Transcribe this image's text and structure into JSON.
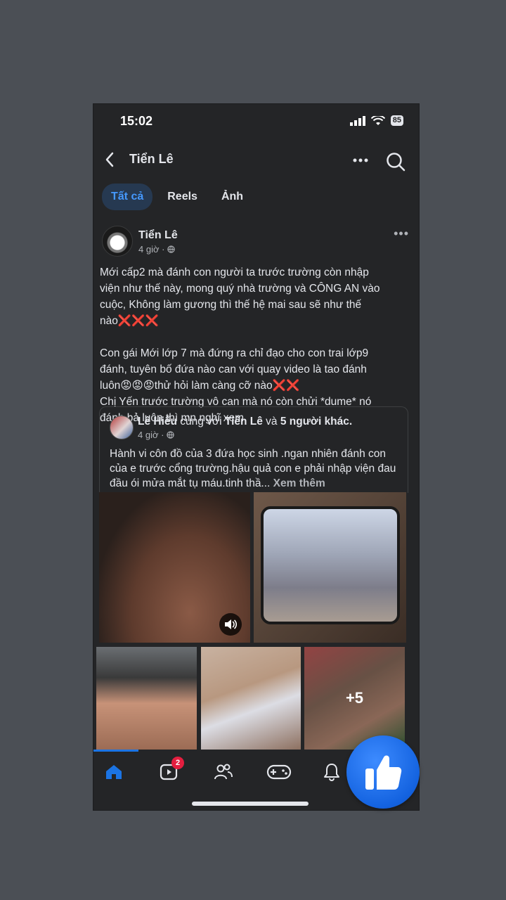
{
  "status": {
    "time": "15:02",
    "battery": "85"
  },
  "header": {
    "title": "Tiển Lê"
  },
  "tabs": [
    {
      "label": "Tất cả"
    },
    {
      "label": "Reels"
    },
    {
      "label": "Ảnh"
    }
  ],
  "post": {
    "author": "Tiển Lê",
    "time": "4 giờ ·",
    "text": "Mới cấp2 mà đánh con người ta trước trường còn nhập\nviện như thế này, mong quý nhà trường và CÔNG AN vào\ncuộc, Không làm gương thì thế hệ mai sau sẽ như thế\nnào❌❌❌\n\nCon gái Mới lớp 7 mà đứng ra chỉ đạo cho con trai lớp9\nđánh, tuyên bố đứa nào can với quay video là tao đánh\nluôn😡😡😡thử hỏi làm càng cỡ nào❌❌\nChị Yến trước trường vô can mà nó còn chửi *dume* nó\nđánh bả luôn thì mn nghĩ xem"
  },
  "shared": {
    "author": "Lê Hiếu",
    "with_text": " cùng với ",
    "tagged": "Tiển Lê",
    "and_text": " và ",
    "others": "5 người khác.",
    "time": "4 giờ ·",
    "text": "Hành vi côn đồ của 3 đứa học sinh .ngan nhiên đánh con của e trước cổng trường.hậu quả con e phải nhập viện đau đầu ói mửa mắt tụ máu.tinh thầ...",
    "see_more": " Xem thêm"
  },
  "photos": {
    "more_count": "+5"
  },
  "nav": {
    "video_badge": "2"
  },
  "colors": {
    "accent": "#1b74e4",
    "badge": "#e41e3f",
    "background": "#242527"
  }
}
